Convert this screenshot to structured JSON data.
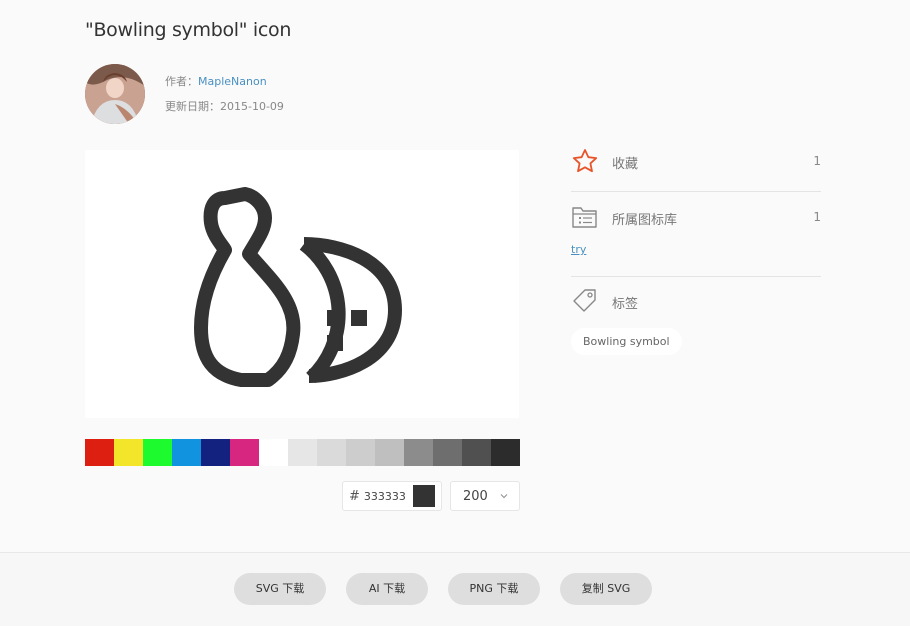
{
  "page": {
    "title": "\"Bowling symbol\" icon"
  },
  "author": {
    "label": "作者：",
    "name": "MapleNanon",
    "date_label": "更新日期：",
    "date": "2015-10-09"
  },
  "palette": {
    "colors": [
      "#dc1f11",
      "#f2e52a",
      "#1dfb2e",
      "#1193e0",
      "#13217f",
      "#d7267f",
      "#ffffff",
      "#e6e6e6",
      "#dadada",
      "#cdcdcd",
      "#bfbfbf",
      "#8c8c8c",
      "#6e6e6e",
      "#505050",
      "#2c2c2c"
    ]
  },
  "color_input": {
    "hash": "#",
    "value": "333333",
    "swatch_color": "#333333"
  },
  "size_select": {
    "value": "200"
  },
  "sidebar": {
    "favorite": {
      "label": "收藏",
      "count": "1",
      "icon": "star-icon"
    },
    "library": {
      "label": "所属图标库",
      "count": "1",
      "icon": "folder-list-icon",
      "link": "try"
    },
    "tags": {
      "label": "标签",
      "icon": "tag-icon",
      "items": [
        "Bowling symbol"
      ]
    }
  },
  "actions": {
    "svg_download": "SVG 下载",
    "ai_download": "AI 下载",
    "png_download": "PNG 下载",
    "copy_svg": "复制 SVG"
  },
  "colors": {
    "accent_link": "#4a90c2",
    "star": "#e8542a",
    "icon_fill": "#333333"
  }
}
